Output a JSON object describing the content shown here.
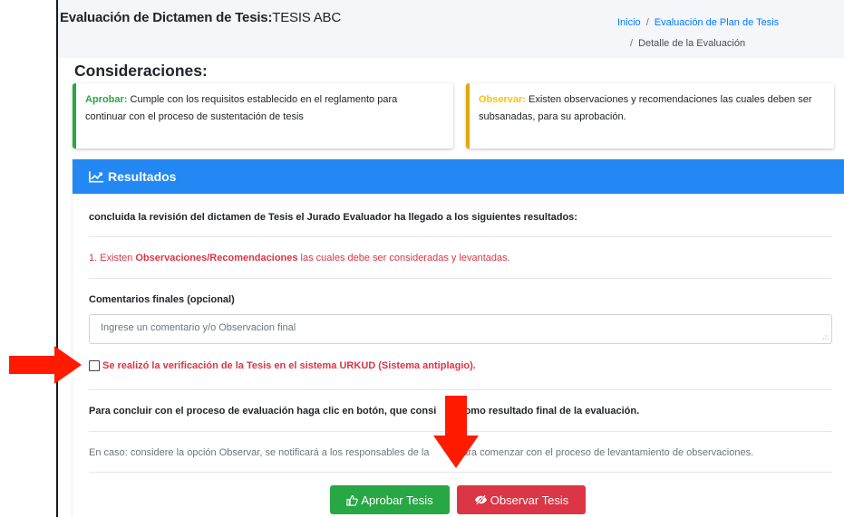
{
  "header": {
    "title_bold": "Evaluación de Dictamen de Tesis:",
    "title_name": "TESIS ABC",
    "breadcrumb": {
      "home": "Inicio",
      "sep": "/",
      "plan": "Evaluación de Plan de Tesis",
      "detail": "Detalle de la Evaluación"
    }
  },
  "considerations": {
    "title": "Consideraciones:",
    "approve": {
      "key": "Aprobar:",
      "line1": "Cumple con los requisitos establecido en el reglamento para",
      "line2": "continuar con el proceso de sustentación de tesis"
    },
    "observe": {
      "key": "Observar:",
      "line1": "Existen observaciones y recomendaciones las cuales deben ser",
      "line2": "subsanadas, para su aprobación."
    }
  },
  "results": {
    "title": "Resultados",
    "intro": "concluida la revisión del dictamen de Tesis el Jurado Evaluador ha llegado a los siguientes resultados:",
    "finding_prefix": "1. Existen ",
    "finding_bold": "Observaciones/Recomendaciones",
    "finding_suffix": " las cuales debe ser consideradas y levantadas.",
    "comments_label": "Comentarios finales (opcional)",
    "comments_placeholder": "Ingrese un comentario y/o Observacion final",
    "checkbox_label": "Se realizó la verificación de la Tesis en el sistema URKUD (Sistema antiplagio).",
    "conclude_part1": "Para concluir con el proceso de evaluación haga clic en botón, que consi",
    "conclude_part2": "e como resultado final de la evaluación.",
    "note_part1": "En caso: considere la opción Observar, se notificará a los responsables de la",
    "note_part2": "s para comenzar con el proceso de levantamiento de observaciones.",
    "approve_button": "Aprobar Tesis",
    "observe_button": "Observar Tesis"
  },
  "colors": {
    "primary": "#2388f4",
    "success": "#28a745",
    "danger": "#dc3545",
    "warning": "#ffc107",
    "annotation_arrow": "#ff1a00"
  },
  "icons": {
    "results": "chart-line-icon",
    "approve": "thumbs-up-icon",
    "observe": "eye-slash-icon",
    "annotation": "red-arrow-icon"
  }
}
